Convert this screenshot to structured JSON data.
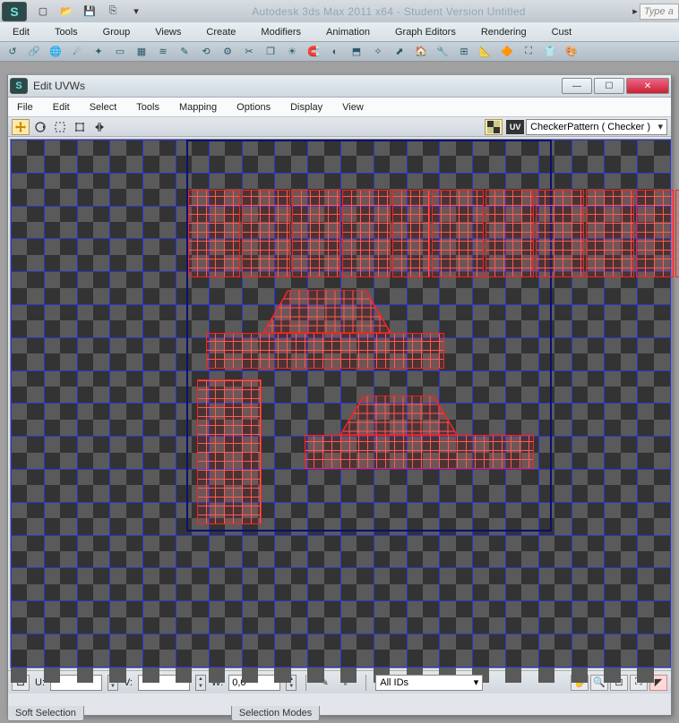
{
  "app": {
    "title": "Autodesk 3ds Max  2011 x64  - Student Version    Untitled",
    "search_hint": "Type a"
  },
  "main_menu": [
    "Edit",
    "Tools",
    "Group",
    "Views",
    "Create",
    "Modifiers",
    "Animation",
    "Graph Editors",
    "Rendering",
    "Cust"
  ],
  "uvw": {
    "title": "Edit UVWs",
    "menu": [
      "File",
      "Edit",
      "Select",
      "Tools",
      "Mapping",
      "Options",
      "Display",
      "View"
    ],
    "uv_label": "UV",
    "texture_dd": "CheckerPattern  ( Checker )",
    "coords": {
      "u_label": "U:",
      "u_val": "",
      "v_label": "V:",
      "v_val": "",
      "w_label": "W:",
      "w_val": "0,0"
    },
    "ids_dd": "All IDs"
  },
  "panels": {
    "soft": "Soft Selection",
    "sel": "Selection Modes"
  },
  "icons": {
    "new": "new-file-icon",
    "open": "open-icon",
    "save": "save-icon",
    "savecfg": "save-config-icon",
    "move": "move-icon",
    "rotate": "rotate-icon",
    "scale": "scale-icon",
    "freeform": "freeform-icon",
    "mirror": "mirror-icon",
    "checker": "checker-icon",
    "pan": "pan-icon",
    "zoom": "zoom-icon",
    "zoomreg": "zoom-region-icon",
    "fit": "zoom-extents-icon",
    "snap": "snap-icon",
    "paint": "paint-icon",
    "norm": "normalize-icon"
  },
  "grid": {
    "cells": 40,
    "uv_start": 0.27,
    "uv_end": 0.785
  },
  "chart_data": null
}
